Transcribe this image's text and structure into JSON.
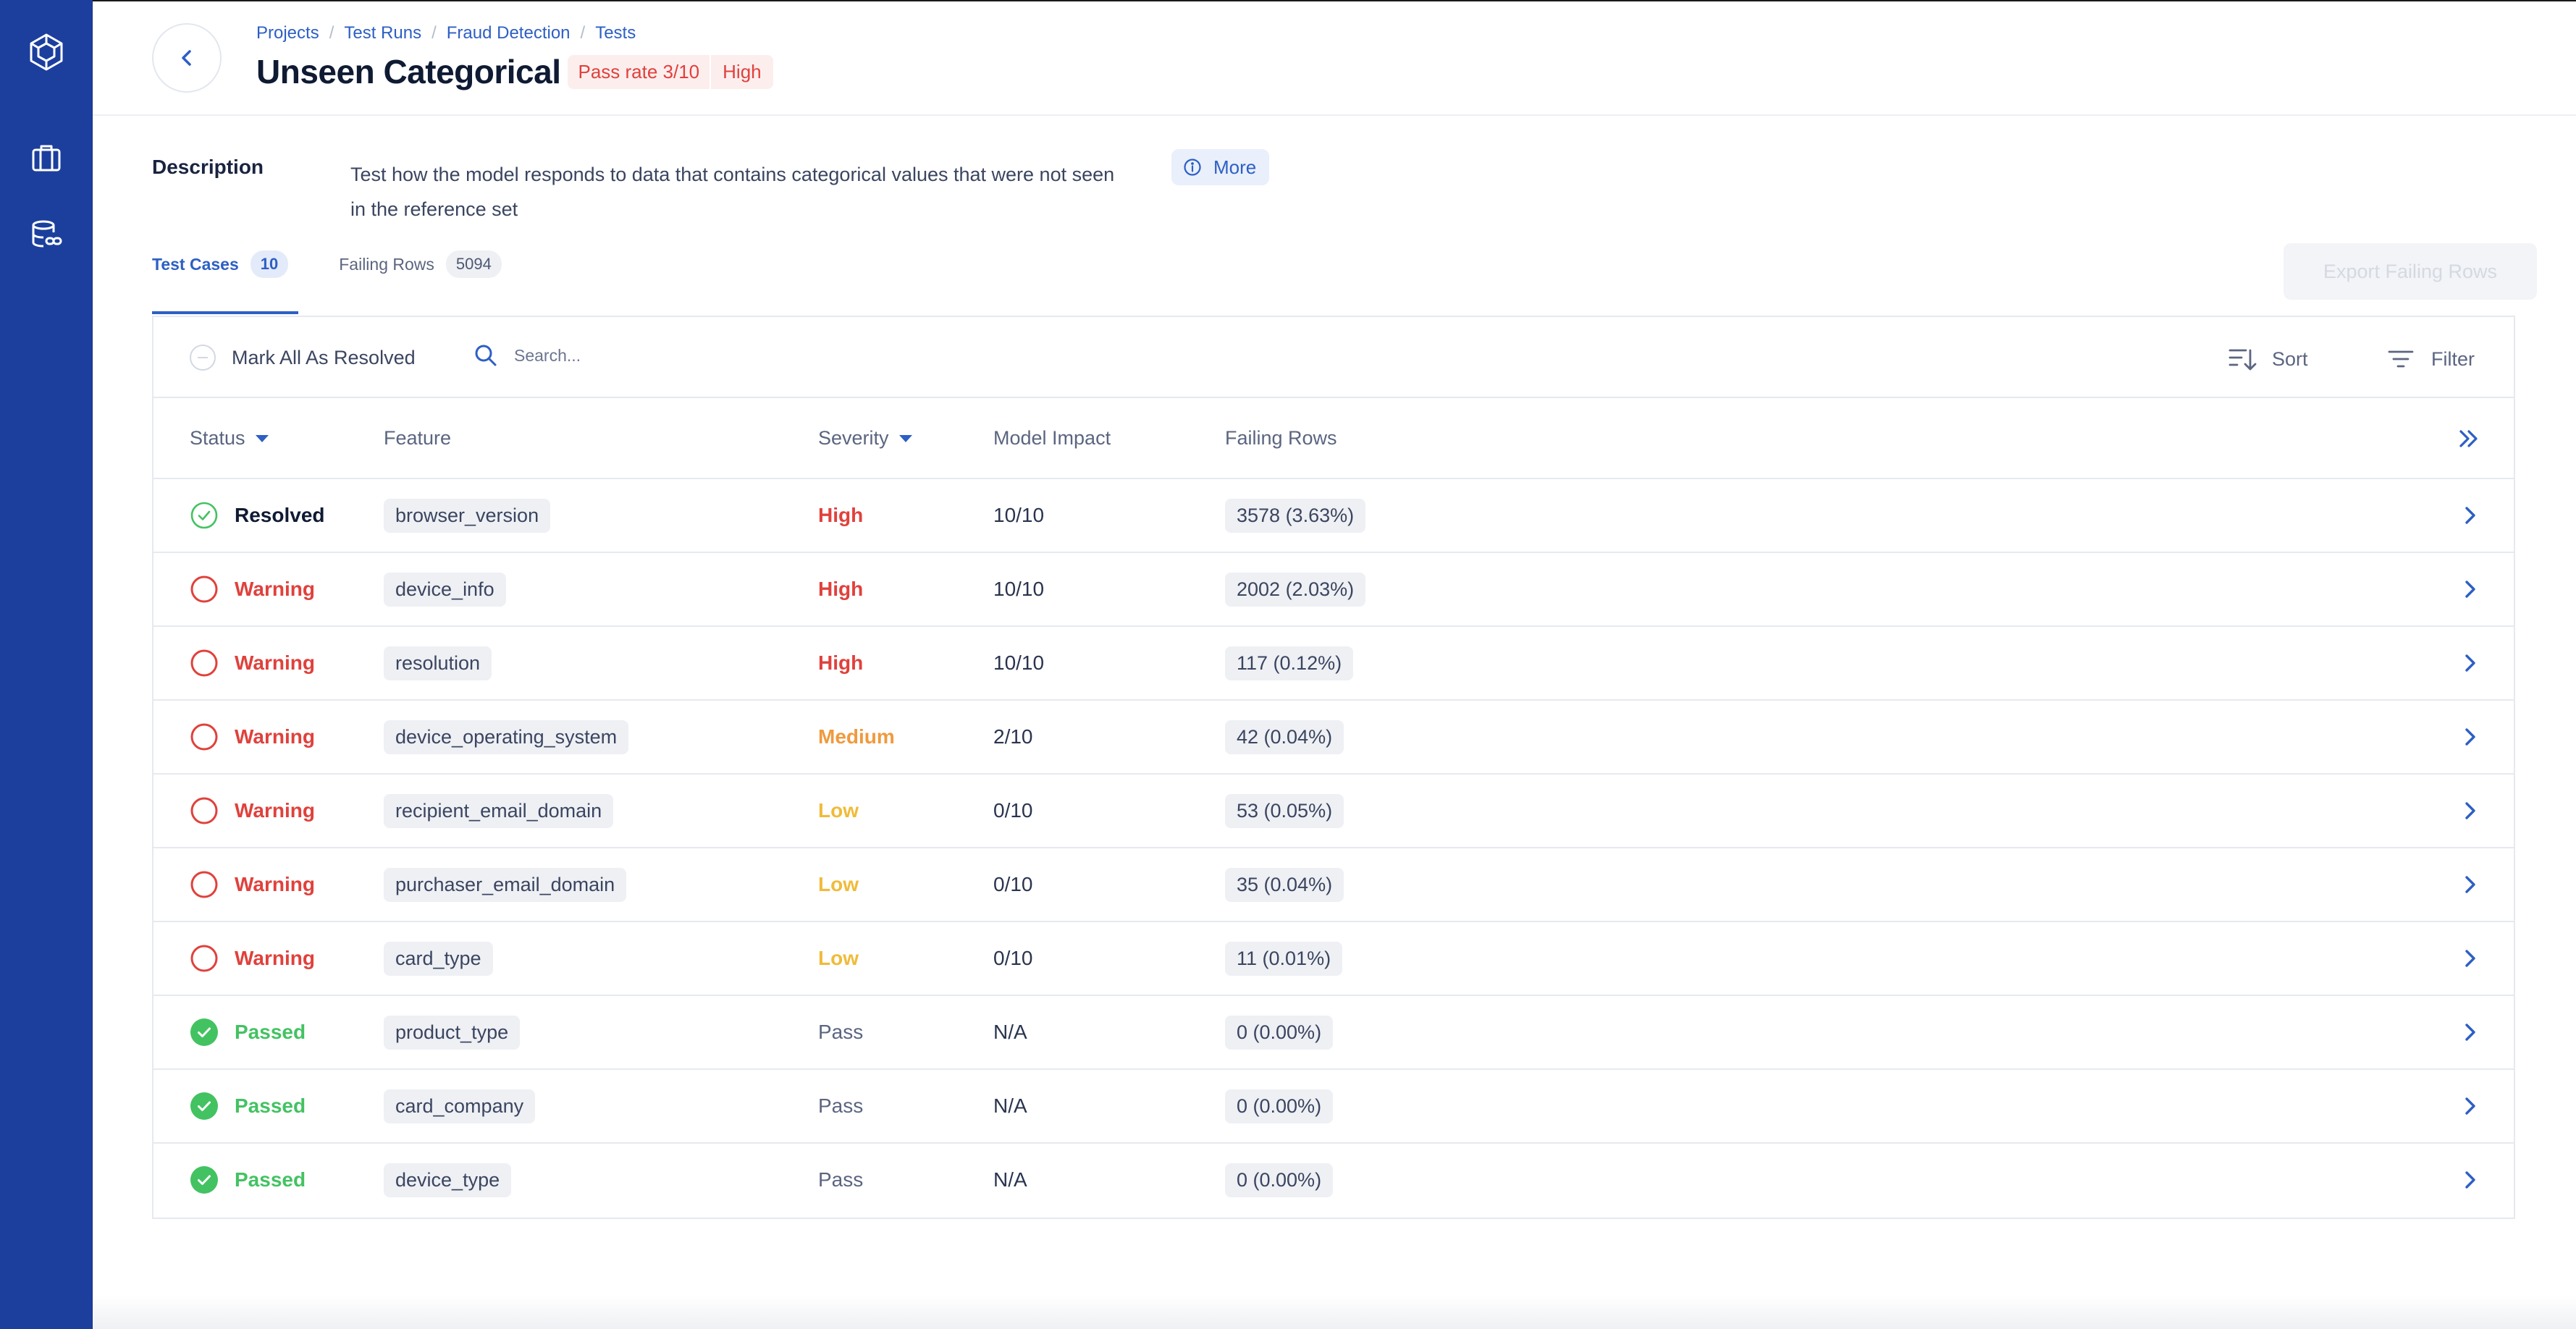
{
  "breadcrumb": [
    "Projects",
    "Test Runs",
    "Fraud Detection",
    "Tests"
  ],
  "title": "Unseen Categorical",
  "badges": {
    "pass_rate": "Pass rate 3/10",
    "severity": "High"
  },
  "description": {
    "label": "Description",
    "text": "Test how the model responds to data that contains categorical values that were not seen in the reference set",
    "more_label": "More"
  },
  "tabs": [
    {
      "label": "Test Cases",
      "count": "10",
      "active": true
    },
    {
      "label": "Failing Rows",
      "count": "5094",
      "active": false
    }
  ],
  "export_label": "Export Failing Rows",
  "toolbar": {
    "mark_all_label": "Mark All As Resolved",
    "search_placeholder": "Search...",
    "sort_label": "Sort",
    "filter_label": "Filter"
  },
  "columns": [
    "Status",
    "Feature",
    "Severity",
    "Model Impact",
    "Failing Rows"
  ],
  "rows": [
    {
      "status": "Resolved",
      "feature": "browser_version",
      "severity": "High",
      "impact": "10/10",
      "failing": "3578 (3.63%)"
    },
    {
      "status": "Warning",
      "feature": "device_info",
      "severity": "High",
      "impact": "10/10",
      "failing": "2002 (2.03%)"
    },
    {
      "status": "Warning",
      "feature": "resolution",
      "severity": "High",
      "impact": "10/10",
      "failing": "117 (0.12%)"
    },
    {
      "status": "Warning",
      "feature": "device_operating_system",
      "severity": "Medium",
      "impact": "2/10",
      "failing": "42 (0.04%)"
    },
    {
      "status": "Warning",
      "feature": "recipient_email_domain",
      "severity": "Low",
      "impact": "0/10",
      "failing": "53 (0.05%)"
    },
    {
      "status": "Warning",
      "feature": "purchaser_email_domain",
      "severity": "Low",
      "impact": "0/10",
      "failing": "35 (0.04%)"
    },
    {
      "status": "Warning",
      "feature": "card_type",
      "severity": "Low",
      "impact": "0/10",
      "failing": "11 (0.01%)"
    },
    {
      "status": "Passed",
      "feature": "product_type",
      "severity": "Pass",
      "impact": "N/A",
      "failing": "0 (0.00%)"
    },
    {
      "status": "Passed",
      "feature": "card_company",
      "severity": "Pass",
      "impact": "N/A",
      "failing": "0 (0.00%)"
    },
    {
      "status": "Passed",
      "feature": "device_type",
      "severity": "Pass",
      "impact": "N/A",
      "failing": "0 (0.00%)"
    }
  ],
  "colors": {
    "sidebar": "#1c3f9e",
    "accent": "#2d5fc4",
    "danger": "#e0413c",
    "medium": "#ef9a3e",
    "low": "#f0bb3a",
    "success": "#43c262"
  },
  "icons": {
    "sidebar": [
      "logo-hexagon-icon",
      "briefcase-icon",
      "database-link-icon"
    ],
    "back": "chevron-left-icon",
    "more": "info-icon",
    "search": "search-icon",
    "sort": "sort-icon",
    "filter": "filter-icon",
    "expand": "double-chevron-right-icon",
    "row": "chevron-right-icon"
  }
}
